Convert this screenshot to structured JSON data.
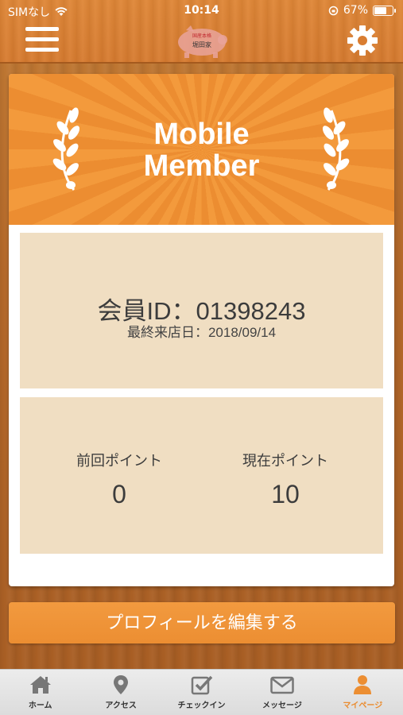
{
  "status_bar": {
    "carrier": "SIMなし",
    "time": "10:14",
    "battery": "67%"
  },
  "header": {
    "logo_text_top": "国産本格",
    "logo_text_main": "堀田家"
  },
  "card": {
    "banner_title_line1": "Mobile",
    "banner_title_line2": "Member",
    "member_id": "会員ID：01398243",
    "last_visit": "最終来店日：2018/09/14",
    "previous_points_label": "前回ポイント",
    "previous_points_value": "0",
    "current_points_label": "現在ポイント",
    "current_points_value": "10"
  },
  "edit_profile_label": "プロフィールを編集する",
  "tabs": [
    {
      "label": "ホーム",
      "icon": "home-icon"
    },
    {
      "label": "アクセス",
      "icon": "map-pin-icon"
    },
    {
      "label": "チェックイン",
      "icon": "checkin-icon"
    },
    {
      "label": "メッセージ",
      "icon": "mail-icon"
    },
    {
      "label": "マイページ",
      "icon": "user-icon"
    }
  ],
  "colors": {
    "accent": "#ec8e32",
    "panel": "#f0dec2",
    "active_tab": "#ea8b2e"
  }
}
